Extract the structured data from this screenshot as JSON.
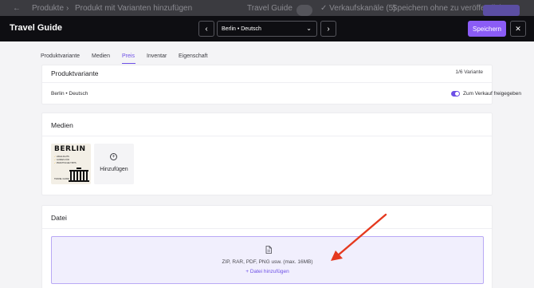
{
  "background_bar": {
    "back_icon": "←",
    "crumb_products": "Produkte",
    "crumb_separator": "›",
    "crumb_add_variant": "Produkt mit Varianten hinzufügen",
    "app_name": "Travel Guide",
    "sales_channels": "✓ Verkaufskanäle (5)",
    "save_unpublished": "Speichern ohne zu veröffentlichen"
  },
  "header": {
    "title": "Travel Guide",
    "prev_icon": "‹",
    "next_icon": "›",
    "variant_selector": "Berlin • Deutsch",
    "variant_selector_chevron": "⌄",
    "save_label": "Speichern",
    "close_label": "✕"
  },
  "tabs": [
    {
      "label": "Produktvariante",
      "active": false
    },
    {
      "label": "Medien",
      "active": false
    },
    {
      "label": "Preis",
      "active": true
    },
    {
      "label": "Inventar",
      "active": false
    },
    {
      "label": "Eigenschaft",
      "active": false
    }
  ],
  "variant_card": {
    "title": "Produktvariante",
    "counter": "1/6 Variante",
    "variant_name": "Berlin • Deutsch",
    "toggle_label": "Zum Verkauf freigegeben",
    "toggle_on": true
  },
  "media_card": {
    "title": "Medien",
    "thumbnail": {
      "title": "BERLIN",
      "lines": [
        "HIGHLIGHTS",
        "GUIDES FÜR",
        "PRAKTISCHE TIPPS"
      ],
      "footer": "TRAVEL GUIDE"
    },
    "add_label": "Hinzufügen"
  },
  "file_card": {
    "title": "Datei",
    "hint": "ZIP, RAR, PDF, PNG usw. (max. 16MB)",
    "add_label": "+  Datei hinzufügen"
  },
  "colors": {
    "accent": "#8b5cf6",
    "header_bg": "#0e0e12",
    "annotation_arrow": "#e5391f"
  },
  "icons": {
    "file": "file-icon",
    "plus": "plus-circle-icon",
    "close": "close-icon",
    "chevron_left": "chevron-left-icon",
    "chevron_right": "chevron-right-icon"
  }
}
